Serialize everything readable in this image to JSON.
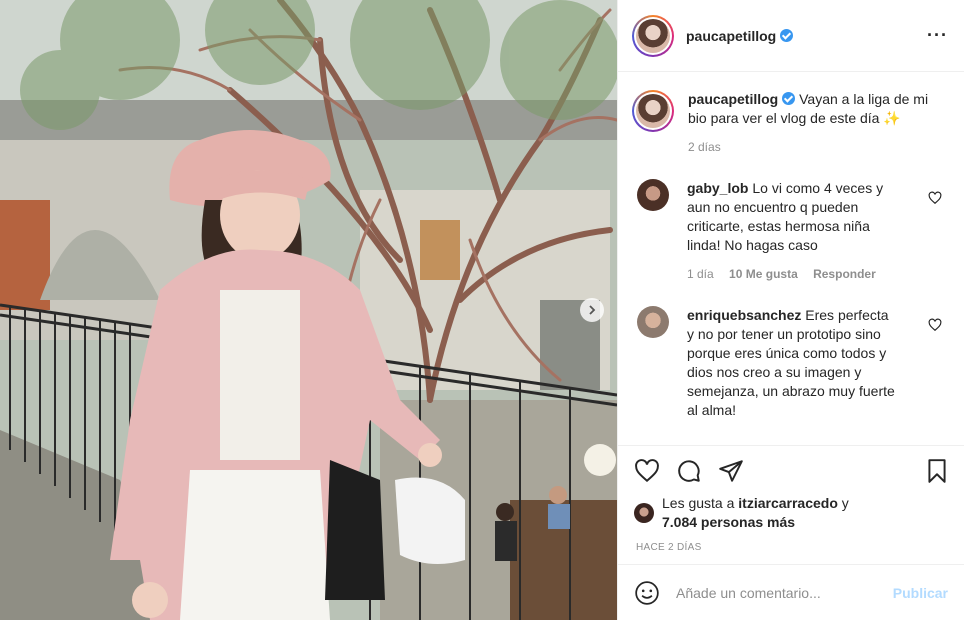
{
  "post": {
    "username": "paucapetillog",
    "verified": true,
    "more_icon": "more-horizontal-icon",
    "caption": {
      "username": "paucapetillog",
      "text": "Vayan a la liga de mi bio para ver el vlog de este día ✨",
      "age": "2 días"
    },
    "comments": [
      {
        "username": "gaby_lob",
        "text": "Lo vi como 4 veces y aun no encuentro q pueden criticarte, estas hermosa niña linda! No hagas caso",
        "age": "1 día",
        "likes": "10 Me gusta",
        "reply": "Responder"
      },
      {
        "username": "enriquebsanchez",
        "text": "Eres perfecta y no por tener un prototipo sino porque eres única como todos y dios nos creo a su imagen y semejanza, un abrazo muy fuerte al alma!"
      }
    ],
    "likes": {
      "prefix": "Les gusta a ",
      "user": "itziarcarracedo",
      "mid": " y",
      "count": "7.084 personas más"
    },
    "timestamp": "HACE 2 DÍAS",
    "add_comment": {
      "placeholder": "Añade un comentario...",
      "publish": "Publicar"
    }
  },
  "colors": {
    "accent_blue": "#3897f0",
    "publish_disabled": "#b3dbff",
    "secondary_text": "#8e8e8e"
  }
}
